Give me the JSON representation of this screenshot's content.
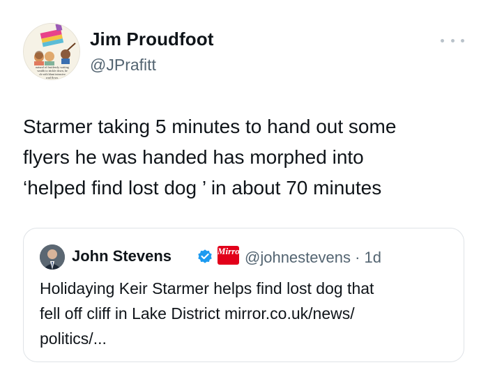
{
  "tweet": {
    "author_name": "Jim Proudfoot",
    "author_handle": "@JPrafitt",
    "avatar_caption_lines": [
      "natural of fruitlessly waiting",
      "wealth to trickle down, he",
      "ch with blunt intrusive",
      "wad flows."
    ],
    "text_lines": [
      "Starmer taking 5 minutes to hand out some",
      "flyers he was handed has morphed into",
      "‘helped find lost dog ’ in about 70 minutes"
    ],
    "more_icon": "more-horizontal-icon"
  },
  "quoted": {
    "author_name": "John Stevens",
    "verified_icon": "verified-badge-icon",
    "badge_text": "Mirror",
    "meta": "@johnestevens · 1d",
    "text_lines": [
      "Holidaying Keir Starmer helps find lost dog that",
      "fell off cliff in Lake District mirror.co.uk/news/",
      "politics/..."
    ]
  },
  "colors": {
    "text": "#0f1419",
    "secondary": "#536471",
    "verified": "#1d9bf0",
    "mirror_red": "#e2001a",
    "border": "#dfe3e7"
  }
}
